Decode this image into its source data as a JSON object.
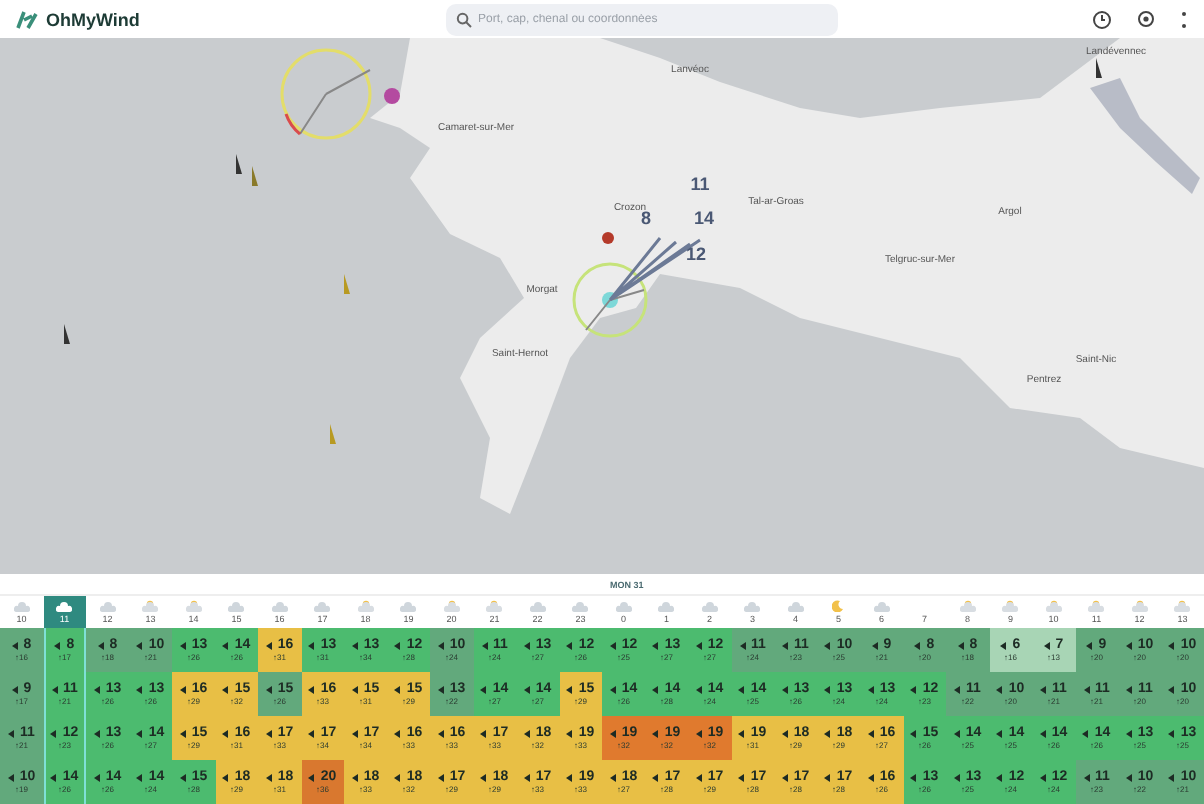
{
  "header": {
    "logo": "OhMyWind",
    "search": {
      "placeholder": "Port, cap, chenal ou coordonnées"
    }
  },
  "map": {
    "places": [
      "Camaret-sur-Mer",
      "Lanvéoc",
      "Crozon",
      "Tal-ar-Groas",
      "Argol",
      "Telgruc-sur-Mer",
      "Morgat",
      "Saint-Hernot",
      "Landévennec",
      "Saint-Nic",
      "Pentrez"
    ],
    "wind_labels": [
      "11",
      "8",
      "14",
      "12"
    ]
  },
  "forecast": {
    "date_label": "MON 31",
    "hours": [
      {
        "hour": "10",
        "kind": "cloud",
        "selected": false
      },
      {
        "hour": "11",
        "kind": "cloud",
        "selected": true
      },
      {
        "hour": "12",
        "kind": "cloud",
        "selected": false
      },
      {
        "hour": "13",
        "kind": "sun",
        "selected": false
      },
      {
        "hour": "14",
        "kind": "sun",
        "selected": false
      },
      {
        "hour": "15",
        "kind": "cloud",
        "selected": false
      },
      {
        "hour": "16",
        "kind": "cloud",
        "selected": false
      },
      {
        "hour": "17",
        "kind": "cloud",
        "selected": false
      },
      {
        "hour": "18",
        "kind": "sun",
        "selected": false
      },
      {
        "hour": "19",
        "kind": "cloud",
        "selected": false
      },
      {
        "hour": "20",
        "kind": "sun",
        "selected": false
      },
      {
        "hour": "21",
        "kind": "sun",
        "selected": false
      },
      {
        "hour": "22",
        "kind": "cloud",
        "selected": false
      },
      {
        "hour": "23",
        "kind": "cloud",
        "selected": false
      },
      {
        "hour": "0",
        "kind": "cloud",
        "selected": false
      },
      {
        "hour": "1",
        "kind": "cloud",
        "selected": false
      },
      {
        "hour": "2",
        "kind": "cloud",
        "selected": false
      },
      {
        "hour": "3",
        "kind": "cloud",
        "selected": false
      },
      {
        "hour": "4",
        "kind": "cloud",
        "selected": false
      },
      {
        "hour": "5",
        "kind": "moon",
        "selected": false
      },
      {
        "hour": "6",
        "kind": "cloud",
        "selected": false
      },
      {
        "hour": "7",
        "selected": false
      },
      {
        "hour": "8",
        "kind": "sun",
        "selected": false
      },
      {
        "hour": "9",
        "kind": "sun",
        "selected": false
      },
      {
        "hour": "10",
        "kind": "sun",
        "selected": false
      },
      {
        "hour": "11",
        "kind": "sun",
        "selected": false
      },
      {
        "hour": "12",
        "kind": "sun",
        "selected": false
      },
      {
        "hour": "13",
        "kind": "sun",
        "selected": false
      }
    ],
    "rows": [
      {
        "cells": [
          {
            "speed": "8",
            "gust": "↑16",
            "color": "#62a97c"
          },
          {
            "speed": "8",
            "gust": "↑17",
            "color": "#4cbb6f"
          },
          {
            "speed": "8",
            "gust": "↑18",
            "color": "#62a97c"
          },
          {
            "speed": "10",
            "gust": "↑21",
            "color": "#62a97c"
          },
          {
            "speed": "13",
            "gust": "↑26",
            "color": "#4cbb6f"
          },
          {
            "speed": "14",
            "gust": "↑26",
            "color": "#4cbb6f"
          },
          {
            "speed": "16",
            "gust": "↑31",
            "color": "#e8bf45"
          },
          {
            "speed": "13",
            "gust": "↑31",
            "color": "#4cbb6f"
          },
          {
            "speed": "13",
            "gust": "↑34",
            "color": "#4cbb6f"
          },
          {
            "speed": "12",
            "gust": "↑28",
            "color": "#4cbb6f"
          },
          {
            "speed": "10",
            "gust": "↑24",
            "color": "#62a97c"
          },
          {
            "speed": "11",
            "gust": "↑24",
            "color": "#4cbb6f"
          },
          {
            "speed": "13",
            "gust": "↑27",
            "color": "#4cbb6f"
          },
          {
            "speed": "12",
            "gust": "↑26",
            "color": "#4cbb6f"
          },
          {
            "speed": "12",
            "gust": "↑25",
            "color": "#4cbb6f"
          },
          {
            "speed": "13",
            "gust": "↑27",
            "color": "#4cbb6f"
          },
          {
            "speed": "12",
            "gust": "↑27",
            "color": "#4cbb6f"
          },
          {
            "speed": "11",
            "gust": "↑24",
            "color": "#62a97c"
          },
          {
            "speed": "11",
            "gust": "↑23",
            "color": "#62a97c"
          },
          {
            "speed": "10",
            "gust": "↑25",
            "color": "#62a97c"
          },
          {
            "speed": "9",
            "gust": "↑21",
            "color": "#62a97c"
          },
          {
            "speed": "8",
            "gust": "↑20",
            "color": "#62a97c"
          },
          {
            "speed": "8",
            "gust": "↑18",
            "color": "#62a97c"
          },
          {
            "speed": "6",
            "gust": "↑16",
            "color": "#a8d5b5"
          },
          {
            "speed": "7",
            "gust": "↑13",
            "color": "#a8d5b5"
          },
          {
            "speed": "9",
            "gust": "↑20",
            "color": "#62a97c"
          },
          {
            "speed": "10",
            "gust": "↑20",
            "color": "#62a97c"
          },
          {
            "speed": "10",
            "gust": "↑20",
            "color": "#62a97c"
          }
        ]
      },
      {
        "cells": [
          {
            "speed": "9",
            "gust": "↑17",
            "color": "#62a97c"
          },
          {
            "speed": "11",
            "gust": "↑21",
            "color": "#4cbb6f"
          },
          {
            "speed": "13",
            "gust": "↑26",
            "color": "#4cbb6f"
          },
          {
            "speed": "13",
            "gust": "↑26",
            "color": "#4cbb6f"
          },
          {
            "speed": "16",
            "gust": "↑29",
            "color": "#e8bf45"
          },
          {
            "speed": "15",
            "gust": "↑32",
            "color": "#e8bf45"
          },
          {
            "speed": "15",
            "gust": "↑26",
            "color": "#62a97c"
          },
          {
            "speed": "16",
            "gust": "↑33",
            "color": "#e8bf45"
          },
          {
            "speed": "15",
            "gust": "↑31",
            "color": "#e8bf45"
          },
          {
            "speed": "15",
            "gust": "↑29",
            "color": "#e8bf45"
          },
          {
            "speed": "13",
            "gust": "↑22",
            "color": "#62a97c"
          },
          {
            "speed": "14",
            "gust": "↑27",
            "color": "#4cbb6f"
          },
          {
            "speed": "14",
            "gust": "↑27",
            "color": "#4cbb6f"
          },
          {
            "speed": "15",
            "gust": "↑29",
            "color": "#e8bf45"
          },
          {
            "speed": "14",
            "gust": "↑26",
            "color": "#4cbb6f"
          },
          {
            "speed": "14",
            "gust": "↑28",
            "color": "#4cbb6f"
          },
          {
            "speed": "14",
            "gust": "↑24",
            "color": "#4cbb6f"
          },
          {
            "speed": "14",
            "gust": "↑25",
            "color": "#4cbb6f"
          },
          {
            "speed": "13",
            "gust": "↑26",
            "color": "#4cbb6f"
          },
          {
            "speed": "13",
            "gust": "↑24",
            "color": "#4cbb6f"
          },
          {
            "speed": "13",
            "gust": "↑24",
            "color": "#4cbb6f"
          },
          {
            "speed": "12",
            "gust": "↑23",
            "color": "#4cbb6f"
          },
          {
            "speed": "11",
            "gust": "↑22",
            "color": "#62a97c"
          },
          {
            "speed": "10",
            "gust": "↑20",
            "color": "#62a97c"
          },
          {
            "speed": "11",
            "gust": "↑21",
            "color": "#62a97c"
          },
          {
            "speed": "11",
            "gust": "↑21",
            "color": "#62a97c"
          },
          {
            "speed": "11",
            "gust": "↑20",
            "color": "#62a97c"
          },
          {
            "speed": "10",
            "gust": "↑20",
            "color": "#62a97c"
          }
        ]
      },
      {
        "cells": [
          {
            "speed": "11",
            "gust": "↑21",
            "color": "#62a97c"
          },
          {
            "speed": "12",
            "gust": "↑23",
            "color": "#4cbb6f"
          },
          {
            "speed": "13",
            "gust": "↑26",
            "color": "#4cbb6f"
          },
          {
            "speed": "14",
            "gust": "↑27",
            "color": "#4cbb6f"
          },
          {
            "speed": "15",
            "gust": "↑29",
            "color": "#e8bf45"
          },
          {
            "speed": "16",
            "gust": "↑31",
            "color": "#e8bf45"
          },
          {
            "speed": "17",
            "gust": "↑33",
            "color": "#e8bf45"
          },
          {
            "speed": "17",
            "gust": "↑34",
            "color": "#e8bf45"
          },
          {
            "speed": "17",
            "gust": "↑34",
            "color": "#e8bf45"
          },
          {
            "speed": "16",
            "gust": "↑33",
            "color": "#e8bf45"
          },
          {
            "speed": "16",
            "gust": "↑33",
            "color": "#e8bf45"
          },
          {
            "speed": "17",
            "gust": "↑33",
            "color": "#e8bf45"
          },
          {
            "speed": "18",
            "gust": "↑32",
            "color": "#e8bf45"
          },
          {
            "speed": "19",
            "gust": "↑33",
            "color": "#e8bf45"
          },
          {
            "speed": "19",
            "gust": "↑32",
            "color": "#e07a2e"
          },
          {
            "speed": "19",
            "gust": "↑32",
            "color": "#e07a2e"
          },
          {
            "speed": "19",
            "gust": "↑32",
            "color": "#e07a2e"
          },
          {
            "speed": "19",
            "gust": "↑31",
            "color": "#e8bf45"
          },
          {
            "speed": "18",
            "gust": "↑29",
            "color": "#e8bf45"
          },
          {
            "speed": "18",
            "gust": "↑29",
            "color": "#e8bf45"
          },
          {
            "speed": "16",
            "gust": "↑27",
            "color": "#e8bf45"
          },
          {
            "speed": "15",
            "gust": "↑26",
            "color": "#4cbb6f"
          },
          {
            "speed": "14",
            "gust": "↑25",
            "color": "#4cbb6f"
          },
          {
            "speed": "14",
            "gust": "↑25",
            "color": "#4cbb6f"
          },
          {
            "speed": "14",
            "gust": "↑26",
            "color": "#4cbb6f"
          },
          {
            "speed": "14",
            "gust": "↑26",
            "color": "#4cbb6f"
          },
          {
            "speed": "13",
            "gust": "↑25",
            "color": "#4cbb6f"
          },
          {
            "speed": "13",
            "gust": "↑25",
            "color": "#4cbb6f"
          }
        ]
      },
      {
        "cells": [
          {
            "speed": "10",
            "gust": "↑19",
            "color": "#62a97c"
          },
          {
            "speed": "14",
            "gust": "↑26",
            "color": "#4cbb6f"
          },
          {
            "speed": "14",
            "gust": "↑26",
            "color": "#4cbb6f"
          },
          {
            "speed": "14",
            "gust": "↑24",
            "color": "#4cbb6f"
          },
          {
            "speed": "15",
            "gust": "↑28",
            "color": "#4cbb6f"
          },
          {
            "speed": "18",
            "gust": "↑29",
            "color": "#e8bf45"
          },
          {
            "speed": "18",
            "gust": "↑31",
            "color": "#e8bf45"
          },
          {
            "speed": "20",
            "gust": "↑36",
            "color": "#d9782f"
          },
          {
            "speed": "18",
            "gust": "↑33",
            "color": "#e8bf45"
          },
          {
            "speed": "18",
            "gust": "↑32",
            "color": "#e8bf45"
          },
          {
            "speed": "17",
            "gust": "↑29",
            "color": "#e8bf45"
          },
          {
            "speed": "18",
            "gust": "↑29",
            "color": "#e8bf45"
          },
          {
            "speed": "17",
            "gust": "↑33",
            "color": "#e8bf45"
          },
          {
            "speed": "19",
            "gust": "↑33",
            "color": "#e8bf45"
          },
          {
            "speed": "18",
            "gust": "↑27",
            "color": "#e8bf45"
          },
          {
            "speed": "17",
            "gust": "↑28",
            "color": "#e8bf45"
          },
          {
            "speed": "17",
            "gust": "↑29",
            "color": "#e8bf45"
          },
          {
            "speed": "17",
            "gust": "↑28",
            "color": "#e8bf45"
          },
          {
            "speed": "17",
            "gust": "↑28",
            "color": "#e8bf45"
          },
          {
            "speed": "17",
            "gust": "↑28",
            "color": "#e8bf45"
          },
          {
            "speed": "16",
            "gust": "↑26",
            "color": "#e8bf45"
          },
          {
            "speed": "13",
            "gust": "↑26",
            "color": "#4cbb6f"
          },
          {
            "speed": "13",
            "gust": "↑25",
            "color": "#4cbb6f"
          },
          {
            "speed": "12",
            "gust": "↑24",
            "color": "#4cbb6f"
          },
          {
            "speed": "12",
            "gust": "↑24",
            "color": "#4cbb6f"
          },
          {
            "speed": "11",
            "gust": "↑23",
            "color": "#62a97c"
          },
          {
            "speed": "10",
            "gust": "↑22",
            "color": "#62a97c"
          },
          {
            "speed": "10",
            "gust": "↑21",
            "color": "#62a97c"
          }
        ]
      }
    ]
  }
}
